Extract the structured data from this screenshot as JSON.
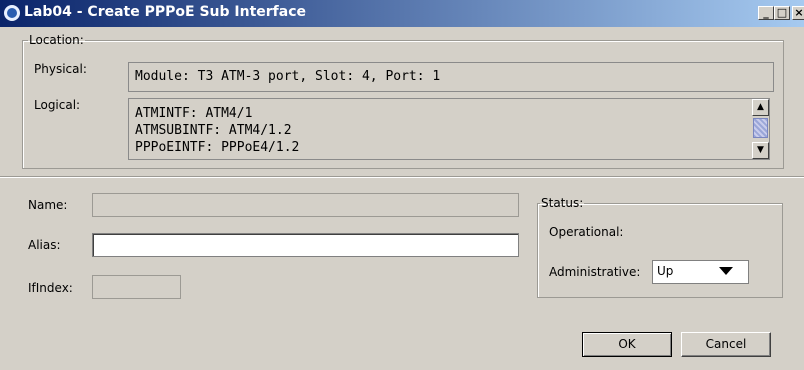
{
  "window": {
    "title": "Lab04 - Create PPPoE Sub Interface",
    "icon": "app-globe-icon",
    "controls": {
      "minimize": "_",
      "maximize": "□",
      "close": "×"
    }
  },
  "location": {
    "legend": "Location:",
    "physical_label": "Physical:",
    "physical_value": "Module: T3 ATM-3 port, Slot: 4, Port: 1",
    "logical_label": "Logical:",
    "logical_lines": [
      "ATMINTF: ATM4/1",
      "ATMSUBINTF: ATM4/1.2",
      "PPPoEINTF: PPPoE4/1.2"
    ]
  },
  "form": {
    "name_label": "Name:",
    "name_value": "",
    "alias_label": "Alias:",
    "alias_value": "",
    "ifindex_label": "IfIndex:",
    "ifindex_value": ""
  },
  "status": {
    "legend": "Status:",
    "operational_label": "Operational:",
    "operational_value": "",
    "administrative_label": "Administrative:",
    "administrative_value": "Up"
  },
  "buttons": {
    "ok": "OK",
    "cancel": "Cancel"
  }
}
